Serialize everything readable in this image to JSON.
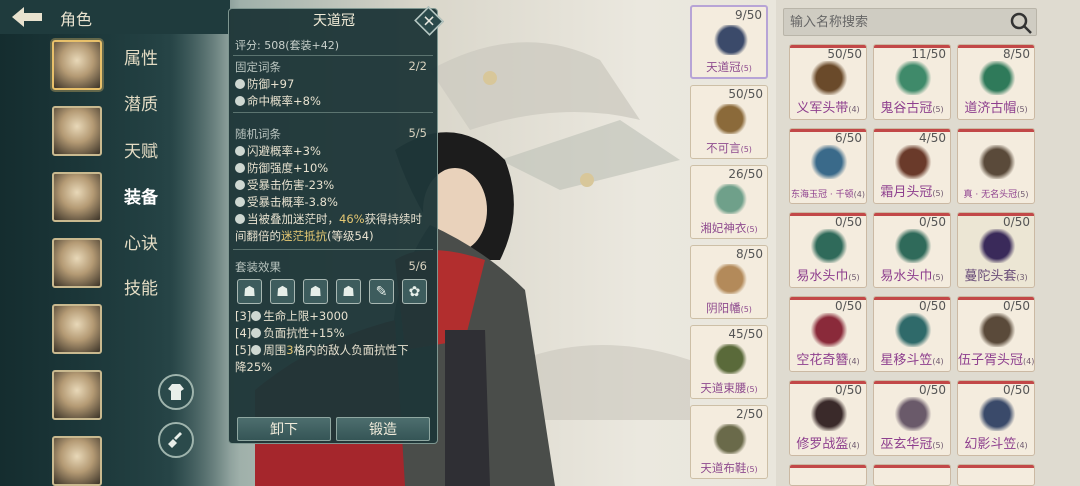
{
  "header": {
    "title": "角色"
  },
  "tabs": [
    {
      "label": "属性",
      "active": false
    },
    {
      "label": "潜质",
      "active": false
    },
    {
      "label": "天赋",
      "active": false
    },
    {
      "label": "装备",
      "active": true
    },
    {
      "label": "心诀",
      "active": false
    },
    {
      "label": "技能",
      "active": false
    }
  ],
  "tooltip": {
    "title": "天道冠",
    "score": "评分: 508(套装+42)",
    "fixed_header": "固定词条",
    "fixed_count": "2/2",
    "fixed": [
      "防御+97",
      "命中概率+8%"
    ],
    "random_header": "随机词条",
    "random_count": "5/5",
    "random": [
      "闪避概率+3%",
      "防御强度+10%",
      "受暴击伤害-23%",
      "受暴击概率-3.8%"
    ],
    "special_a": "当被叠加迷茫时，",
    "special_b": "46%",
    "special_c": "获得持续时",
    "special_d": "间翻倍的",
    "special_e": "迷茫抵抗",
    "special_f": "(等级54)",
    "set_header": "套装效果",
    "set_count": "5/6",
    "set_effects": [
      {
        "tier": "[3]",
        "text": "生命上限",
        "value": "+3000"
      },
      {
        "tier": "[4]",
        "text": "负面抗性",
        "value": "+15%"
      },
      {
        "tier": "[5]",
        "text_a": "周围",
        "num": "3",
        "text_b": "格内的敌人负面抗性下"
      }
    ],
    "set_effect_tail": "降",
    "set_effect_tail_value": "25%",
    "unequip_label": "卸下",
    "forge_label": "锻造",
    "close_symbol": "✕"
  },
  "equipped": [
    {
      "name": "天道冠",
      "quality": "(5)",
      "count": "9/50",
      "color": "#3b4a6a"
    },
    {
      "name": "不可言",
      "quality": "(5)",
      "count": "50/50",
      "color": "#8b6a3a"
    },
    {
      "name": "湘妃神衣",
      "quality": "(5)",
      "count": "26/50",
      "color": "#6fa08a"
    },
    {
      "name": "阴阳幡",
      "quality": "(5)",
      "count": "8/50",
      "color": "#b38a5a"
    },
    {
      "name": "天道束腰",
      "quality": "(5)",
      "count": "45/50",
      "color": "#5a6a3a"
    },
    {
      "name": "天道布鞋",
      "quality": "(5)",
      "count": "2/50",
      "color": "#6a6a4a"
    }
  ],
  "search": {
    "placeholder": "输入名称搜索"
  },
  "inventory": [
    {
      "name": "义军头带",
      "quality": "(4)",
      "count": "50/50",
      "color": "#6a4a2a",
      "small": false
    },
    {
      "name": "鬼谷古冠",
      "quality": "(5)",
      "count": "11/50",
      "color": "#3f8a6a",
      "small": false
    },
    {
      "name": "道济古帽",
      "quality": "(5)",
      "count": "8/50",
      "color": "#2f7a5a",
      "small": false
    },
    {
      "name": "东海玉冠 · 千顿",
      "quality": "(4)",
      "count": "6/50",
      "color": "#3a6a8a",
      "small": true
    },
    {
      "name": "霜月头冠",
      "quality": "(5)",
      "count": "4/50",
      "color": "#6a3a2a",
      "small": false
    },
    {
      "name": "真 · 无名头冠",
      "quality": "(5)",
      "count": "",
      "color": "#5a4a3a",
      "small": true
    },
    {
      "name": "易水头巾",
      "quality": "(5)",
      "count": "0/50",
      "color": "#2f6a5a",
      "small": false
    },
    {
      "name": "易水头巾",
      "quality": "(5)",
      "count": "0/50",
      "color": "#2f6a5a",
      "small": false
    },
    {
      "name": "蔓陀头套",
      "quality": "(3)",
      "count": "0/50",
      "color": "#3a2a5a",
      "small": false
    },
    {
      "name": "空花奇簪",
      "quality": "(4)",
      "count": "0/50",
      "color": "#8a2a3a",
      "small": false
    },
    {
      "name": "星移斗笠",
      "quality": "(4)",
      "count": "0/50",
      "color": "#2f6a6a",
      "small": false
    },
    {
      "name": "伍子胥头冠",
      "quality": "(4)",
      "count": "0/50",
      "color": "#5a4a3a",
      "small": false
    },
    {
      "name": "修罗战盔",
      "quality": "(4)",
      "count": "0/50",
      "color": "#3a2a2a",
      "small": false
    },
    {
      "name": "巫玄华冠",
      "quality": "(5)",
      "count": "0/50",
      "color": "#6a5a6a",
      "small": false
    },
    {
      "name": "幻影斗笠",
      "quality": "(4)",
      "count": "0/50",
      "color": "#3a4a6a",
      "small": false
    }
  ]
}
